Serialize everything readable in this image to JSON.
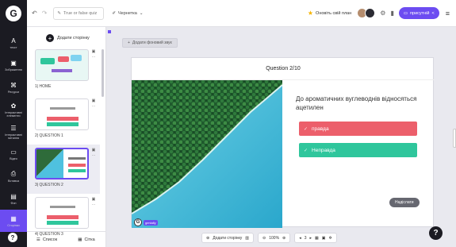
{
  "topbar": {
    "logo_letter": "G",
    "undo_icon": "undo-icon",
    "redo_icon": "redo-icon",
    "title": "True or false quiz",
    "status": "Чернетка",
    "upgrade_plan": "Оновіть свій план",
    "present_label": "присутній"
  },
  "leftnav": {
    "items": [
      {
        "icon": "A",
        "label": "текст"
      },
      {
        "icon": "▣",
        "label": "Зображення"
      },
      {
        "icon": "⌘",
        "label": "Ресурси"
      },
      {
        "icon": "✿",
        "label": "Інтерактивні елементи"
      },
      {
        "icon": "☰",
        "label": "Інтерактивні питання"
      },
      {
        "icon": "▭",
        "label": "Відео"
      },
      {
        "icon": "⎙",
        "label": "Вставка"
      },
      {
        "icon": "▤",
        "label": "Фон"
      },
      {
        "icon": "▦",
        "label": "Сторінки"
      }
    ],
    "help": "?"
  },
  "slides_panel": {
    "add_page": "Додати сторінку",
    "slides": [
      {
        "label": "1| HOME"
      },
      {
        "label": "2| QUESTION 1"
      },
      {
        "label": "3| QUESTION 2"
      },
      {
        "label": "4| QUESTION 3"
      }
    ],
    "tab_list": "Список",
    "tab_grid": "Сітка"
  },
  "editor": {
    "add_background": "Додати фоновий звук",
    "question_counter": "Question 2/10",
    "question_text": "До ароматичних вуглеводнів відносяться ацетилен",
    "answer_true": "правда",
    "answer_false": "Неправда",
    "submit": "Надіслати",
    "brand_letter": "G",
    "brand_text": "genially"
  },
  "bottombar": {
    "add_page": "Додати сторінку",
    "zoom": "100%",
    "page": "3"
  },
  "colors": {
    "accent": "#6c4cf1",
    "answer_true": "#ec5f6b",
    "answer_false": "#2fc69c",
    "nav_bg": "#1b1b22"
  }
}
